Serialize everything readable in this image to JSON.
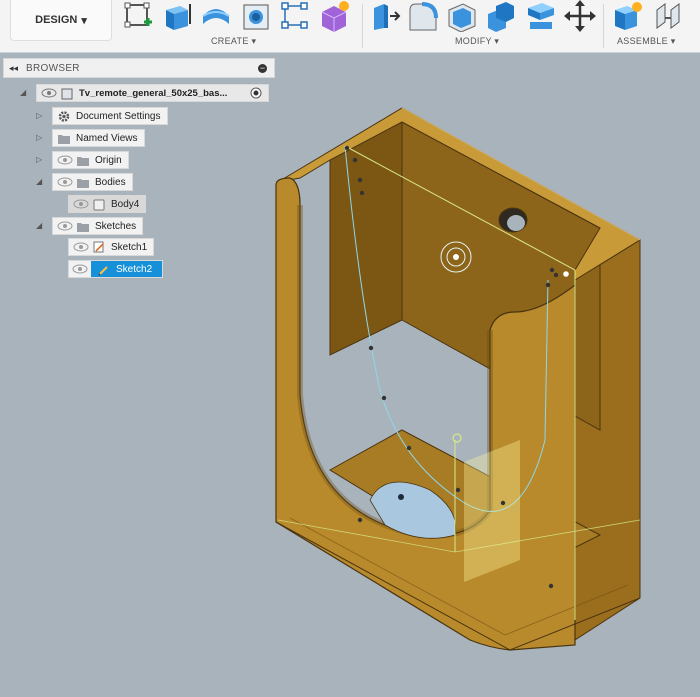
{
  "workspace": {
    "label": "DESIGN"
  },
  "toolbar": {
    "groups": [
      {
        "label": "CREATE ▾"
      },
      {
        "label": "MODIFY ▾"
      },
      {
        "label": "ASSEMBLE ▾"
      }
    ]
  },
  "browser": {
    "title": "BROWSER",
    "root": "Tv_remote_general_50x25_bas...",
    "items": [
      {
        "label": "Document Settings"
      },
      {
        "label": "Named Views"
      },
      {
        "label": "Origin"
      },
      {
        "label": "Bodies"
      },
      {
        "label": "Body4"
      },
      {
        "label": "Sketches"
      },
      {
        "label": "Sketch1"
      },
      {
        "label": "Sketch2"
      }
    ]
  },
  "colors": {
    "toolbar_bg": "#f4f4f4",
    "viewport_bg": "#a9b3bc",
    "body_color": "#b88a2c",
    "selection": "#1690d8",
    "sketch_line": "#d8e88a"
  }
}
